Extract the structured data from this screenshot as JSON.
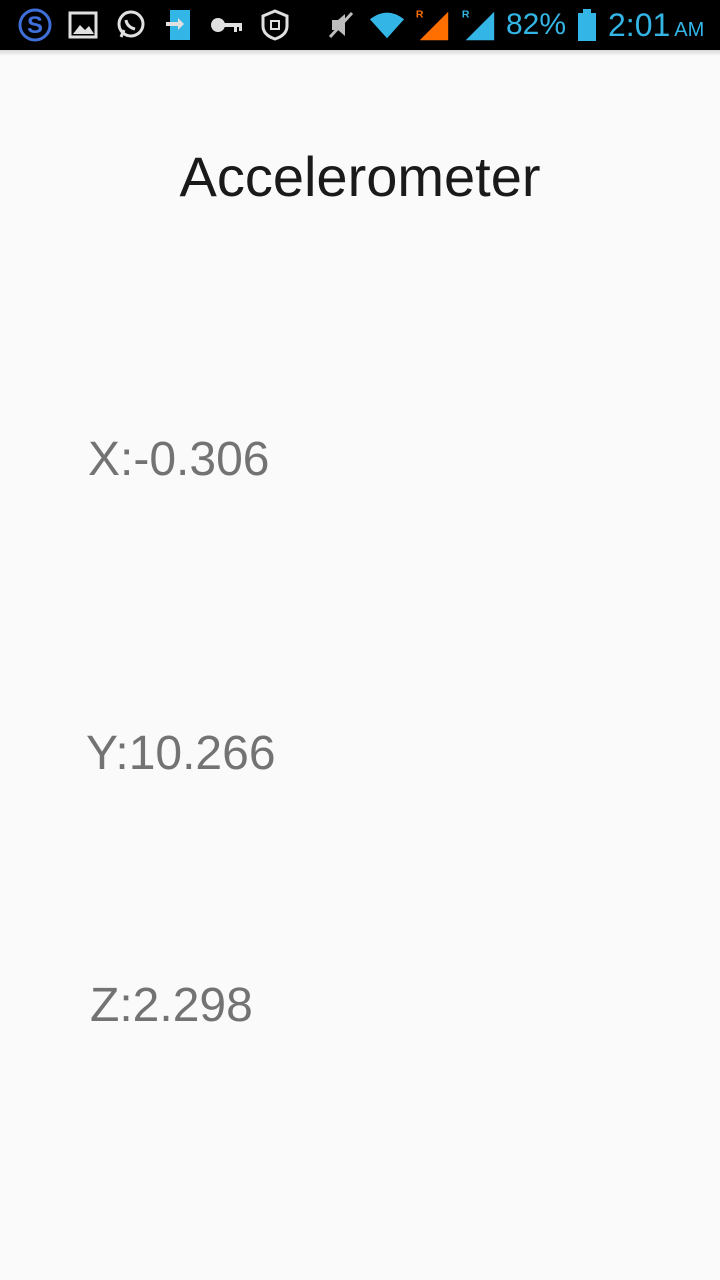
{
  "status_bar": {
    "icons": [
      "s-app-icon",
      "gallery-icon",
      "whatsapp-icon",
      "sim-transfer-icon",
      "key-icon",
      "shield-icon",
      "mute-icon",
      "wifi-icon",
      "signal-roaming-icon-1",
      "signal-roaming-icon-2",
      "battery-icon"
    ],
    "battery_percent": "82%",
    "time": "2:01",
    "ampm": "AM",
    "accent_color": "#33b5e5"
  },
  "title": "Accelerometer",
  "readings": {
    "x": "X:-0.306",
    "y": "Y:10.266",
    "z": "Z:2.298"
  }
}
